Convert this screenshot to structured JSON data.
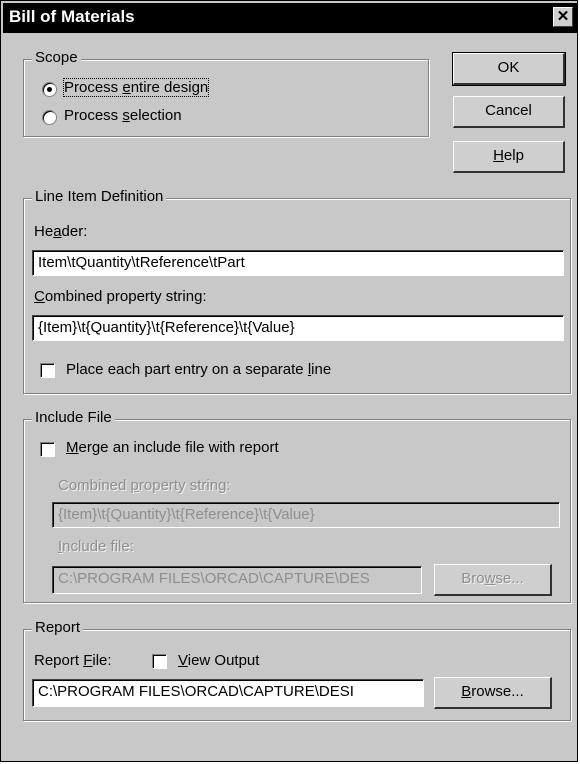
{
  "title": "Bill of Materials",
  "close_glyph": "✕",
  "buttons": {
    "ok": "OK",
    "cancel": "Cancel",
    "help": "Help",
    "browse_include": "Browse...",
    "browse_report": "Browse..."
  },
  "scope": {
    "legend": "Scope",
    "option_entire": "Process entire design",
    "option_selection": "Process selection",
    "selected": "entire"
  },
  "line_item": {
    "legend": "Line Item Definition",
    "header_label": "Header:",
    "header_value": "Item\\tQuantity\\tReference\\tPart",
    "combined_label": "Combined property string:",
    "combined_value": "{Item}\\t{Quantity}\\t{Reference}\\t{Value}",
    "separate_line_label": "Place each part entry on a separate line",
    "separate_line_checked": false
  },
  "include_file": {
    "legend": "Include File",
    "merge_label": "Merge an include file with report",
    "merge_checked": false,
    "combined_label": "Combined property string:",
    "combined_value": "{Item}\\t{Quantity}\\t{Reference}\\t{Value}",
    "include_label": "Include file:",
    "include_value": "C:\\PROGRAM FILES\\ORCAD\\CAPTURE\\DES"
  },
  "report": {
    "legend": "Report",
    "report_file_label": "Report File:",
    "view_output_label": "View Output",
    "view_output_checked": false,
    "report_file_value": "C:\\PROGRAM FILES\\ORCAD\\CAPTURE\\DESI"
  }
}
